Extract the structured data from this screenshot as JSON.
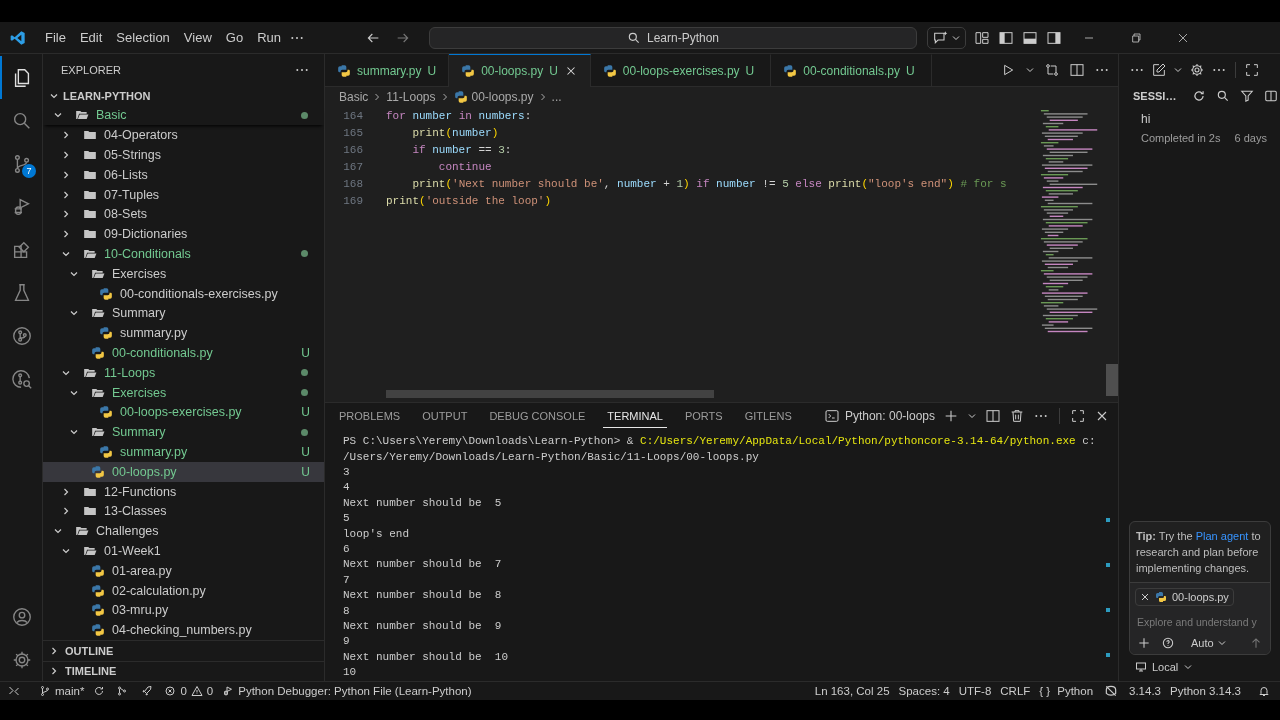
{
  "title_bar": {
    "menu": [
      "File",
      "Edit",
      "Selection",
      "View",
      "Go",
      "Run"
    ],
    "search": {
      "value": "Learn-Python"
    }
  },
  "activity_bar": {
    "top": [
      {
        "kind": "explorer",
        "selected": true
      },
      {
        "kind": "search",
        "selected": false
      },
      {
        "kind": "source_control",
        "selected": false,
        "badge": "7"
      },
      {
        "kind": "run",
        "selected": false
      },
      {
        "kind": "extensions",
        "selected": false
      },
      {
        "kind": "testing",
        "selected": false
      },
      {
        "kind": "gitlens",
        "selected": false
      },
      {
        "kind": "inspect",
        "selected": false
      }
    ],
    "bottom": [
      {
        "kind": "accounts"
      },
      {
        "kind": "settings"
      }
    ]
  },
  "explorer": {
    "title": "EXPLORER",
    "root": "LEARN-PYTHON",
    "tree": [
      {
        "name": "Basic",
        "kind": "folder",
        "expanded": true,
        "untracked": true,
        "dot": true,
        "selected": false,
        "children": [
          {
            "name": "04-Operators",
            "kind": "folder",
            "expanded": false,
            "untracked": false,
            "dot": false,
            "selected": false
          },
          {
            "name": "05-Strings",
            "kind": "folder",
            "expanded": false,
            "untracked": false,
            "dot": false,
            "selected": false
          },
          {
            "name": "06-Lists",
            "kind": "folder",
            "expanded": false,
            "untracked": false,
            "dot": false,
            "selected": false
          },
          {
            "name": "07-Tuples",
            "kind": "folder",
            "expanded": false,
            "untracked": false,
            "dot": false,
            "selected": false
          },
          {
            "name": "08-Sets",
            "kind": "folder",
            "expanded": false,
            "untracked": false,
            "dot": false,
            "selected": false
          },
          {
            "name": "09-Dictionaries",
            "kind": "folder",
            "expanded": false,
            "untracked": false,
            "dot": false,
            "selected": false
          },
          {
            "name": "10-Conditionals",
            "kind": "folder",
            "expanded": true,
            "untracked": true,
            "dot": true,
            "selected": false,
            "children": [
              {
                "name": "Exercises",
                "kind": "folder",
                "expanded": true,
                "untracked": false,
                "dot": false,
                "selected": false,
                "children": [
                  {
                    "name": "00-conditionals-exercises.py",
                    "kind": "file",
                    "untracked": false,
                    "selected": false
                  }
                ]
              },
              {
                "name": "Summary",
                "kind": "folder",
                "expanded": true,
                "untracked": false,
                "dot": false,
                "selected": false,
                "children": [
                  {
                    "name": "summary.py",
                    "kind": "file",
                    "untracked": false,
                    "selected": false
                  }
                ]
              },
              {
                "name": "00-conditionals.py",
                "kind": "file",
                "untracked": true,
                "badge": "U",
                "selected": false
              }
            ]
          },
          {
            "name": "11-Loops",
            "kind": "folder",
            "expanded": true,
            "untracked": true,
            "dot": true,
            "selected": false,
            "children": [
              {
                "name": "Exercises",
                "kind": "folder",
                "expanded": true,
                "untracked": true,
                "dot": true,
                "selected": false,
                "children": [
                  {
                    "name": "00-loops-exercises.py",
                    "kind": "file",
                    "untracked": true,
                    "badge": "U",
                    "selected": false
                  }
                ]
              },
              {
                "name": "Summary",
                "kind": "folder",
                "expanded": true,
                "untracked": true,
                "dot": true,
                "selected": false,
                "children": [
                  {
                    "name": "summary.py",
                    "kind": "file",
                    "untracked": true,
                    "badge": "U",
                    "selected": false
                  }
                ]
              },
              {
                "name": "00-loops.py",
                "kind": "file",
                "untracked": true,
                "badge": "U",
                "selected": true
              }
            ]
          },
          {
            "name": "12-Functions",
            "kind": "folder",
            "expanded": false,
            "untracked": false,
            "dot": false,
            "selected": false
          },
          {
            "name": "13-Classes",
            "kind": "folder",
            "expanded": false,
            "untracked": false,
            "dot": false,
            "selected": false
          }
        ]
      },
      {
        "name": "Challenges",
        "kind": "folder",
        "expanded": true,
        "untracked": false,
        "dot": false,
        "selected": false,
        "children": [
          {
            "name": "01-Week1",
            "kind": "folder",
            "expanded": true,
            "untracked": false,
            "dot": false,
            "selected": false,
            "children": [
              {
                "name": "01-area.py",
                "kind": "file",
                "untracked": false,
                "selected": false
              },
              {
                "name": "02-calculation.py",
                "kind": "file",
                "untracked": false,
                "selected": false
              },
              {
                "name": "03-mru.py",
                "kind": "file",
                "untracked": false,
                "selected": false
              },
              {
                "name": "04-checking_numbers.py",
                "kind": "file",
                "untracked": false,
                "selected": false
              }
            ]
          }
        ]
      }
    ],
    "sections": [
      "OUTLINE",
      "TIMELINE"
    ]
  },
  "editor": {
    "tabs": [
      {
        "label": "summary.py",
        "badge": "U",
        "selected": false
      },
      {
        "label": "00-loops.py",
        "badge": "U",
        "selected": true
      },
      {
        "label": "00-loops-exercises.py",
        "badge": "U",
        "selected": false
      },
      {
        "label": "00-conditionals.py",
        "badge": "U",
        "selected": false
      }
    ],
    "breadcrumb": [
      "Basic",
      "11-Loops",
      "00-loops.py",
      "..."
    ],
    "lines": [
      {
        "number": "164",
        "tokens": [
          {
            "text": "for",
            "kind": "keyword"
          },
          {
            "text": " number",
            "kind": "var"
          },
          {
            "text": " in",
            "kind": "keyword"
          },
          {
            "text": " numbers",
            "kind": "var"
          },
          {
            "text": ":",
            "kind": "plain"
          }
        ]
      },
      {
        "number": "165",
        "tokens": [
          {
            "text": "    print",
            "kind": "func"
          },
          {
            "text": "(",
            "kind": "paren"
          },
          {
            "text": "number",
            "kind": "var"
          },
          {
            "text": ")",
            "kind": "paren"
          }
        ]
      },
      {
        "number": "166",
        "tokens": [
          {
            "text": "    if",
            "kind": "keyword"
          },
          {
            "text": " number",
            "kind": "var"
          },
          {
            "text": " ==",
            "kind": "plain"
          },
          {
            "text": " 3",
            "kind": "number"
          },
          {
            "text": ":",
            "kind": "plain"
          }
        ]
      },
      {
        "number": "167",
        "tokens": [
          {
            "text": "        continue",
            "kind": "keyword"
          }
        ]
      },
      {
        "number": "168",
        "tokens": [
          {
            "text": "    print",
            "kind": "func"
          },
          {
            "text": "(",
            "kind": "paren"
          },
          {
            "text": "'Next number should be'",
            "kind": "string"
          },
          {
            "text": ",",
            "kind": "plain"
          },
          {
            "text": " number",
            "kind": "var"
          },
          {
            "text": " +",
            "kind": "plain"
          },
          {
            "text": " 1",
            "kind": "number"
          },
          {
            "text": ")",
            "kind": "paren"
          },
          {
            "text": " if",
            "kind": "keyword"
          },
          {
            "text": " number",
            "kind": "var"
          },
          {
            "text": " !=",
            "kind": "plain"
          },
          {
            "text": " 5",
            "kind": "number"
          },
          {
            "text": " else",
            "kind": "keyword"
          },
          {
            "text": " print",
            "kind": "func"
          },
          {
            "text": "(",
            "kind": "paren"
          },
          {
            "text": "\"loop's end\"",
            "kind": "string"
          },
          {
            "text": ")",
            "kind": "paren"
          },
          {
            "text": " # for s",
            "kind": "comment"
          }
        ]
      },
      {
        "number": "169",
        "tokens": [
          {
            "text": "print",
            "kind": "func"
          },
          {
            "text": "(",
            "kind": "paren"
          },
          {
            "text": "'outside the loop'",
            "kind": "string"
          },
          {
            "text": ")",
            "kind": "paren"
          }
        ]
      }
    ]
  },
  "panel": {
    "tabs": [
      {
        "label": "PROBLEMS",
        "selected": false
      },
      {
        "label": "OUTPUT",
        "selected": false
      },
      {
        "label": "DEBUG CONSOLE",
        "selected": false
      },
      {
        "label": "TERMINAL",
        "selected": true
      },
      {
        "label": "PORTS",
        "selected": false
      },
      {
        "label": "GITLENS",
        "selected": false
      }
    ],
    "terminal_name": "Python: 00-loops",
    "terminal": [
      {
        "segments": [
          {
            "text": "PS C:\\Users\\Yeremy\\Downloads\\Learn-Python> &",
            "kind": "plain"
          },
          {
            "text": " C:/Users/Yeremy/AppData/Local/Python/pythoncore-3.14-64/python.exe",
            "kind": "command"
          },
          {
            "text": " c:",
            "kind": "plain"
          }
        ]
      },
      {
        "segments": [
          {
            "text": "/Users/Yeremy/Downloads/Learn-Python/Basic/11-Loops/00-loops.py",
            "kind": "plain"
          }
        ]
      },
      {
        "segments": [
          {
            "text": "3",
            "kind": "plain"
          }
        ]
      },
      {
        "segments": [
          {
            "text": "4",
            "kind": "plain"
          }
        ]
      },
      {
        "segments": [
          {
            "text": "Next number should be  5",
            "kind": "plain"
          }
        ]
      },
      {
        "segments": [
          {
            "text": "5",
            "kind": "plain"
          }
        ]
      },
      {
        "segments": [
          {
            "text": "loop's end",
            "kind": "plain"
          }
        ]
      },
      {
        "segments": [
          {
            "text": "6",
            "kind": "plain"
          }
        ]
      },
      {
        "segments": [
          {
            "text": "Next number should be  7",
            "kind": "plain"
          }
        ]
      },
      {
        "segments": [
          {
            "text": "7",
            "kind": "plain"
          }
        ]
      },
      {
        "segments": [
          {
            "text": "Next number should be  8",
            "kind": "plain"
          }
        ]
      },
      {
        "segments": [
          {
            "text": "8",
            "kind": "plain"
          }
        ]
      },
      {
        "segments": [
          {
            "text": "Next number should be  9",
            "kind": "plain"
          }
        ]
      },
      {
        "segments": [
          {
            "text": "9",
            "kind": "plain"
          }
        ]
      },
      {
        "segments": [
          {
            "text": "Next number should be  10",
            "kind": "plain"
          }
        ]
      },
      {
        "segments": [
          {
            "text": "10",
            "kind": "plain"
          }
        ]
      }
    ]
  },
  "chat": {
    "title": "SESSI…",
    "sessions": [
      {
        "title": "hi",
        "status": "Completed in 2s",
        "time": "6 days"
      }
    ],
    "tip": {
      "before": "**Tip:** Try the",
      "link": "Plan agent",
      "after": "to research and plan before implementing changes."
    },
    "attachment": "00-loops.py",
    "input": {
      "placeholder": "Explore and understand y"
    },
    "mode": "Auto",
    "location": "Local"
  },
  "status_bar": {
    "branch": "main*",
    "errors": "0",
    "warnings": "0",
    "debugger": "Python Debugger: Python File (Learn-Python)",
    "position": "Ln 163, Col 25",
    "spaces": "Spaces: 4",
    "encoding": "UTF-8",
    "eol": "CRLF",
    "language_icon": "{ }",
    "language": "Python",
    "version": "3.14.3",
    "interpreter": "Python 3.14.3"
  }
}
